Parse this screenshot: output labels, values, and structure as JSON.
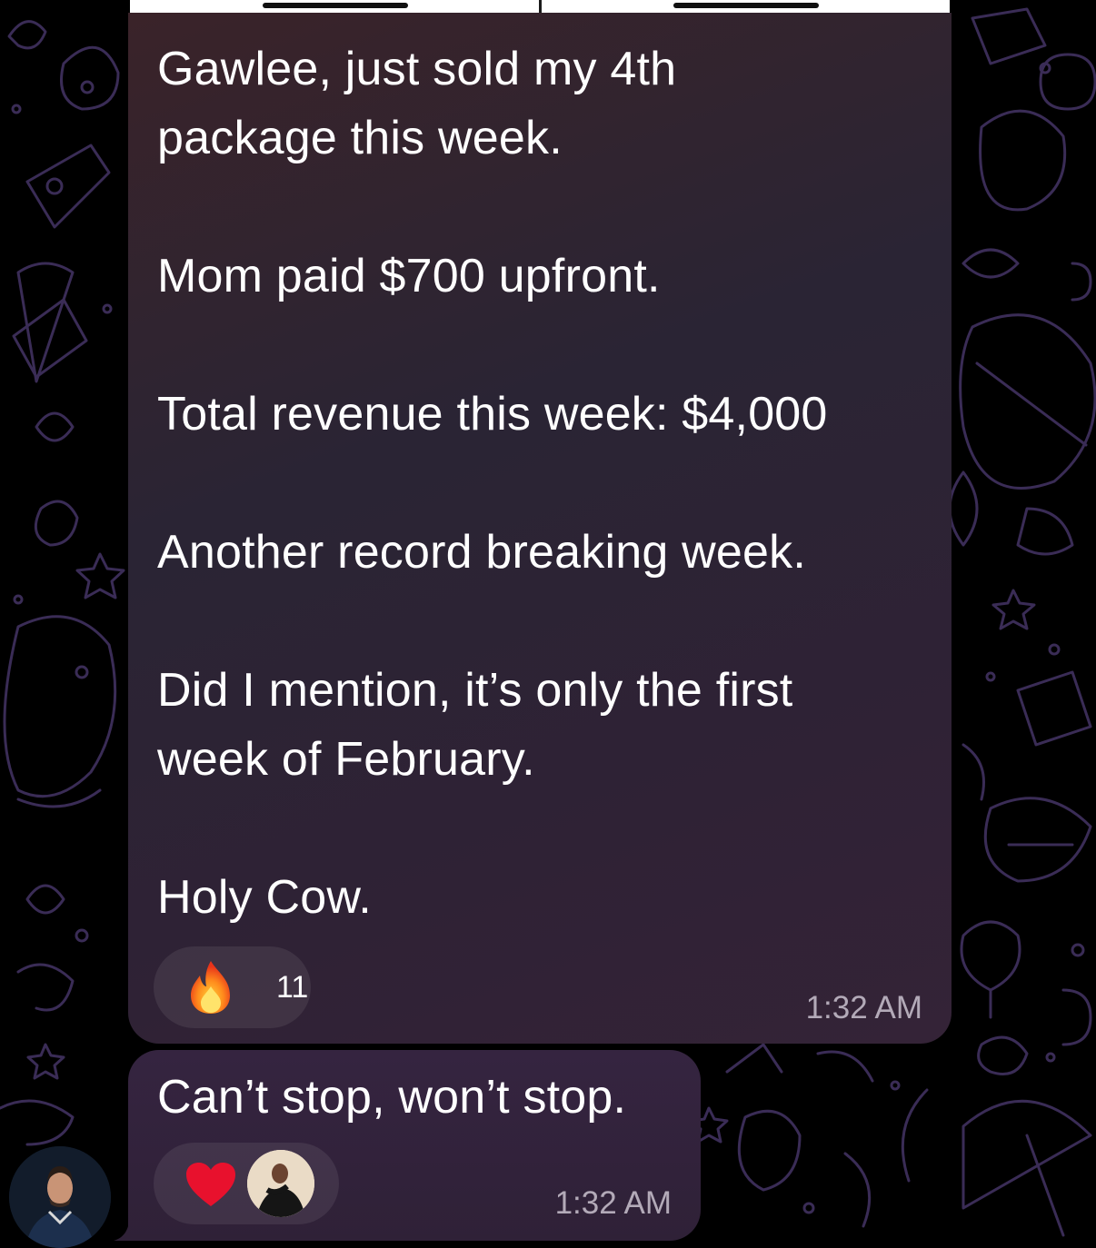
{
  "messages": [
    {
      "lines": [
        "Gawlee, just sold my 4th",
        "package this week.",
        "Mom paid $700 upfront.",
        "Total revenue this week: $4,000",
        "Another record breaking week.",
        "Did I mention, it’s only the first",
        "week of February.",
        "Holy Cow."
      ],
      "reaction": {
        "icon": "fire-icon",
        "count": "11"
      },
      "time": "1:32 AM"
    },
    {
      "lines": [
        "Can’t stop, won’t stop."
      ],
      "reaction": {
        "icon": "red-heart-icon"
      },
      "time": "1:32 AM"
    }
  ],
  "colors": {
    "background": "#000000",
    "bubble": "#2f2236",
    "timestamp": "#b3aab8",
    "doodle_stroke": "#3b2a55"
  }
}
